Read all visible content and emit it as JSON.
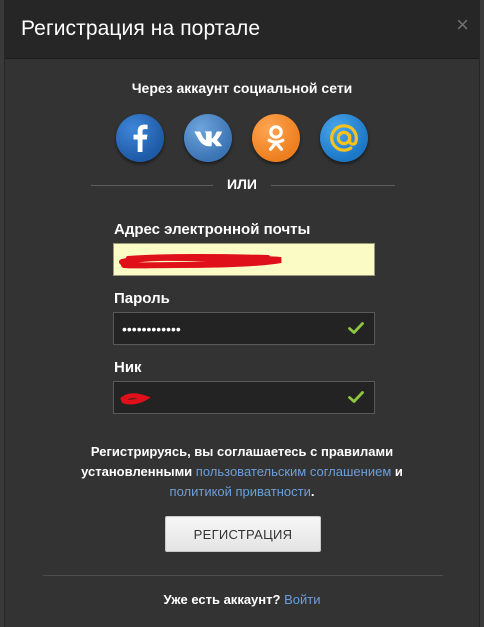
{
  "modal": {
    "title": "Регистрация на портале",
    "close_glyph": "×"
  },
  "social": {
    "caption": "Через аккаунт социальной сети",
    "buttons": [
      {
        "name": "facebook",
        "glyph": "f",
        "icon": "facebook-icon",
        "color": "#1e5aa6"
      },
      {
        "name": "vkontakte",
        "glyph": "vk",
        "icon": "vk-icon",
        "color": "#3b74b4"
      },
      {
        "name": "odnoklassniki",
        "glyph": "ok",
        "icon": "ok-icon",
        "color": "#ed7f1f"
      },
      {
        "name": "mail-ru",
        "glyph": "@",
        "icon": "mail-ru-icon",
        "color": "#1c77c7"
      }
    ]
  },
  "divider_label": "ИЛИ",
  "form": {
    "email_label": "Адрес электронной почты",
    "email_value": "",
    "password_label": "Пароль",
    "password_value": "••••••••••••",
    "nick_label": "Ник",
    "nick_value": ""
  },
  "agreement": {
    "line1": "Регистрируясь, вы соглашаетесь с правилами",
    "line2_prefix": "установленными",
    "user_agreement_link": "пользовательским соглашением",
    "conjunction": "и",
    "privacy_link": "политикой приватности",
    "end": "."
  },
  "register_button": "РЕГИСТРАЦИЯ",
  "login": {
    "prompt": "Уже есть аккаунт?",
    "link": "Войти"
  },
  "colors": {
    "accent_link": "#6b9fdc",
    "check_green": "#8dc63f",
    "redaction": "#e0101a"
  }
}
